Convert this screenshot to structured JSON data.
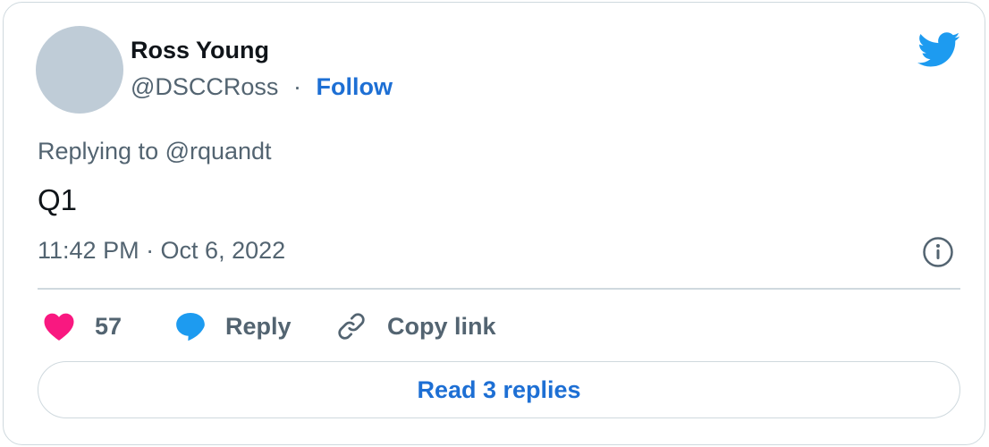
{
  "author": {
    "name": "Ross Young",
    "handle": "@DSCCRoss",
    "separator": "·",
    "follow_label": "Follow"
  },
  "tweet": {
    "replying_to": "Replying to @rquandt",
    "text": "Q1",
    "timestamp": "11:42 PM · Oct 6, 2022"
  },
  "actions": {
    "like_count": "57",
    "reply_label": "Reply",
    "copy_link_label": "Copy link"
  },
  "read_replies_label": "Read 3 replies",
  "colors": {
    "accent": "#1d6fd4",
    "like": "#f91880",
    "reply_icon": "#1d9bf0",
    "twitter_bird": "#1d9bf0",
    "muted_text": "#536471",
    "border": "#cfd9de"
  },
  "icons": {
    "brand": "twitter-bird-icon",
    "info": "info-icon",
    "like": "heart-icon",
    "reply": "speech-bubble-icon",
    "copy_link": "link-icon"
  }
}
